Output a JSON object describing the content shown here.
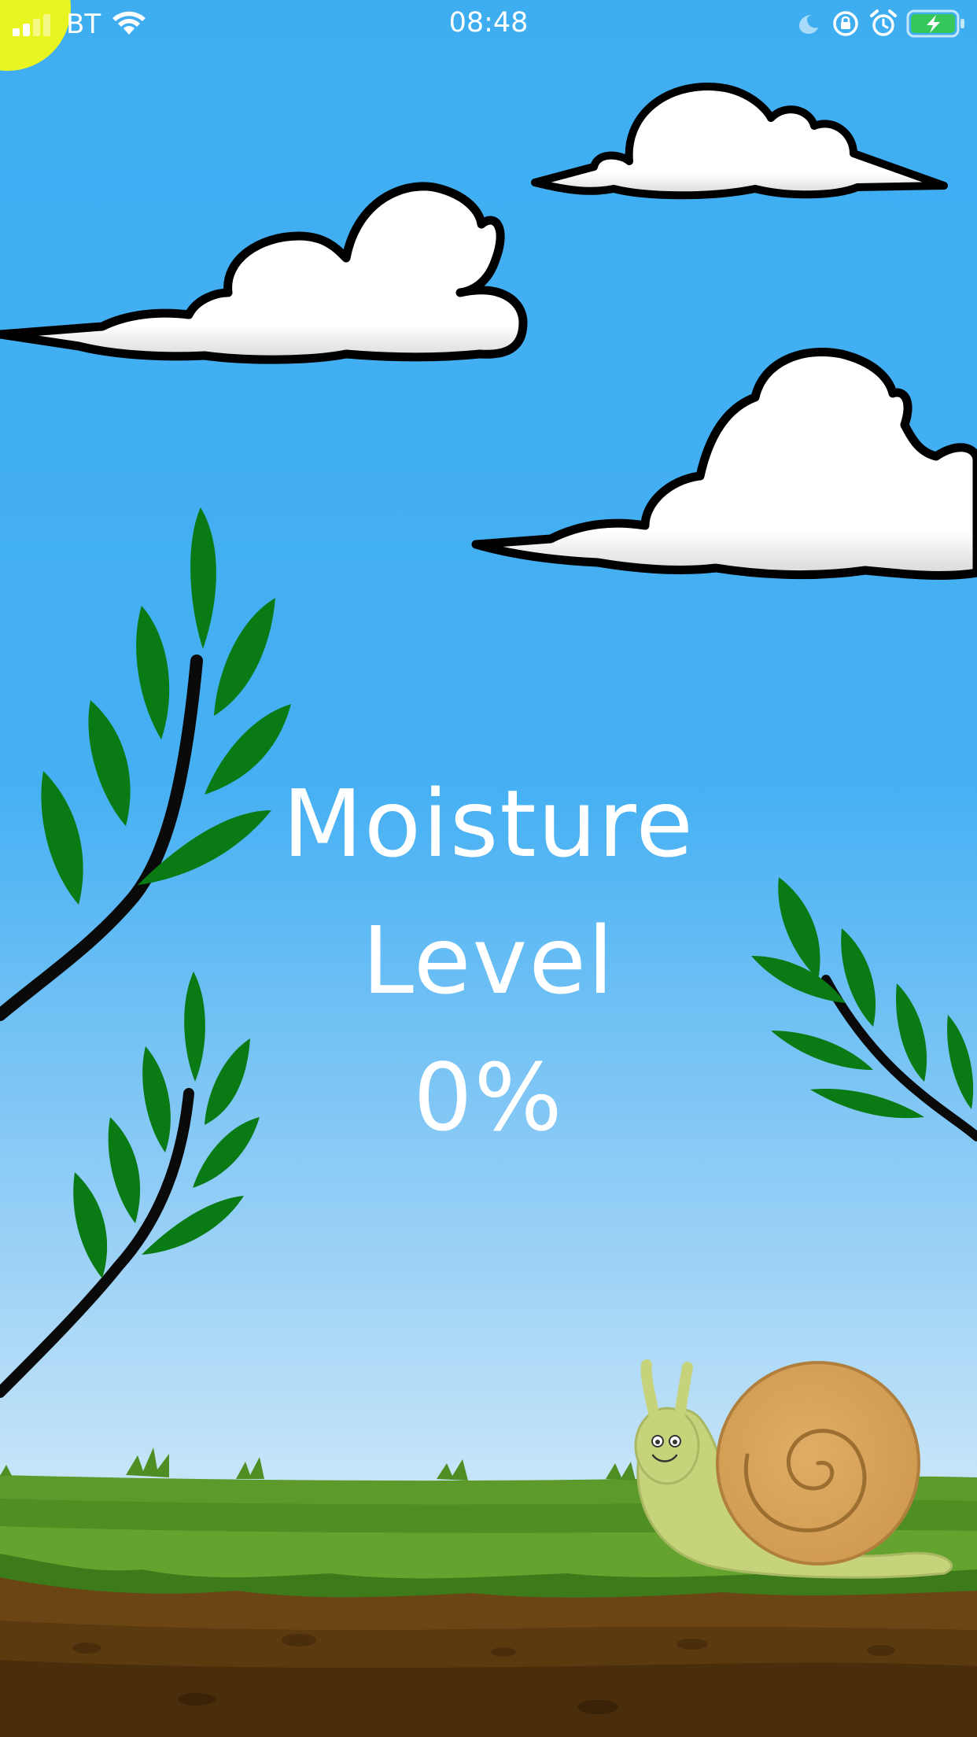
{
  "status_bar": {
    "carrier": "BT",
    "time": "08:48",
    "icons": [
      "signal-icon",
      "wifi-icon",
      "moon-icon",
      "orientation-lock-icon",
      "alarm-icon",
      "battery-charging-icon"
    ]
  },
  "main": {
    "title_line1": "Moisture",
    "title_line2": "Level",
    "value": "0%"
  },
  "colors": {
    "sky_top": "#3faef1",
    "sky_bottom": "#c9e6f8",
    "leaf": "#0a7a14",
    "grass": "#5c9a2c",
    "soil": "#5c3a10",
    "snail_shell": "#d9a35b",
    "snail_body": "#c6d37a",
    "battery": "#35c759"
  }
}
